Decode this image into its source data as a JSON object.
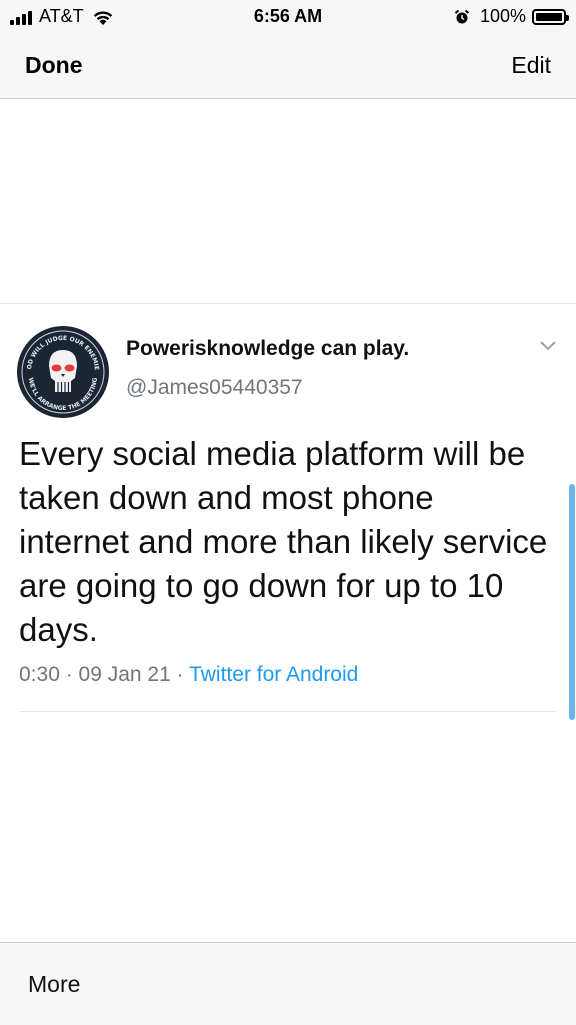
{
  "status_bar": {
    "carrier": "AT&T",
    "time": "6:56 AM",
    "battery": "100%",
    "icons": [
      "signal-icon",
      "wifi-icon",
      "alarm-icon",
      "battery-icon"
    ]
  },
  "nav": {
    "done_label": "Done",
    "edit_label": "Edit"
  },
  "tweet": {
    "display_name": "Powerisknowledge can play.",
    "handle": "@James05440357",
    "text": "Every social media platform will be taken down and most phone internet and more than likely service  are going to go down for up to 10 days.",
    "time": "0:30",
    "date": "09 Jan 21",
    "separator": " · ",
    "source": "Twitter for Android",
    "avatar": {
      "badge_text_top": "GOD WILL JUDGE OUR ENEMIES",
      "badge_text_bottom": "WE'LL ARRANGE THE MEETING"
    }
  },
  "bottom_bar": {
    "more_label": "More"
  },
  "colors": {
    "bar_background": "#f7f7f7",
    "link_blue": "#1d9bf0",
    "secondary_text": "#6e767d",
    "scroll_indicator": "#6ab4e8"
  }
}
